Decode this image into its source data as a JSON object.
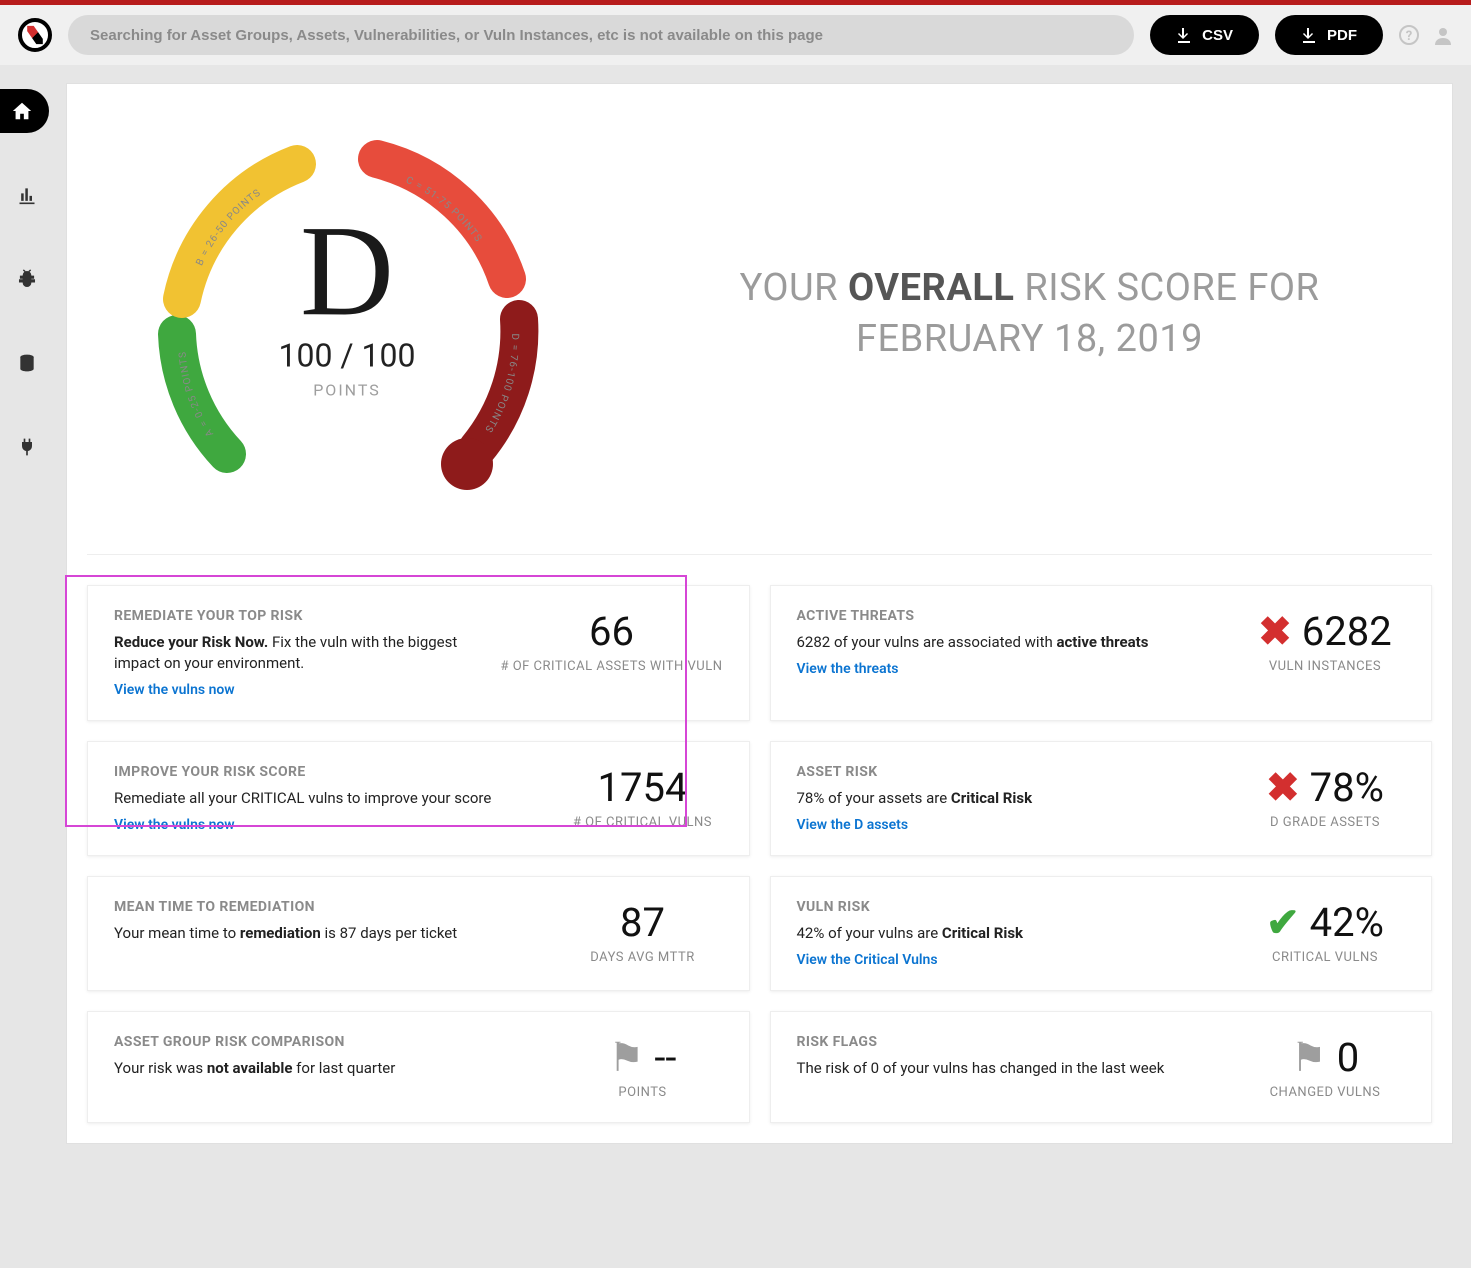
{
  "search": {
    "placeholder": "Searching for Asset Groups, Assets, Vulnerabilities, or Vuln Instances, etc is not available on this page"
  },
  "buttons": {
    "csv": "CSV",
    "pdf": "PDF"
  },
  "hero": {
    "prefix": "YOUR ",
    "strong": "OVERALL",
    "suffix": " RISK SCORE FOR",
    "date": "FEBRUARY 18, 2019",
    "grade": "D",
    "score_value": "100 / 100",
    "score_label": "POINTS",
    "segments": {
      "a": "A = 0-25 POINTS",
      "b": "B = 26-50 POINTS",
      "c": "C = 51-75 POINTS",
      "d": "D = 76-100 POINTS"
    }
  },
  "cards": {
    "remediate": {
      "title": "REMEDIATE YOUR TOP RISK",
      "lead": "Reduce your Risk Now.",
      "desc": " Fix the vuln with the biggest impact on your environment.",
      "link": "View the vulns now",
      "stat": "66",
      "stat_label": "# OF CRITICAL ASSETS WITH VULN"
    },
    "threats": {
      "title": "ACTIVE THREATS",
      "desc_pre": "6282 of your vulns are associated with ",
      "desc_bold": "active threats",
      "link": "View the threats",
      "stat": "6282",
      "stat_label": "VULN INSTANCES"
    },
    "improve": {
      "title": "IMPROVE YOUR RISK SCORE",
      "desc": "Remediate all your CRITICAL vulns to improve your score",
      "link": "View the vulns now",
      "stat": "1754",
      "stat_label": "# OF CRITICAL VULNS"
    },
    "assetrisk": {
      "title": "ASSET RISK",
      "desc_pre": "78% of your assets are ",
      "desc_bold": "Critical Risk",
      "link": "View the D assets",
      "stat": "78%",
      "stat_label": "D GRADE ASSETS"
    },
    "mttr": {
      "title": "MEAN TIME TO REMEDIATION",
      "desc_pre": "Your mean time to ",
      "desc_bold": "remediation",
      "desc_post": " is 87 days per ticket",
      "stat": "87",
      "stat_label": "DAYS AVG MTTR"
    },
    "vulnrisk": {
      "title": "VULN RISK",
      "desc_pre": "42% of your vulns are ",
      "desc_bold": "Critical Risk",
      "link": "View the Critical Vulns",
      "stat": "42%",
      "stat_label": "CRITICAL VULNS"
    },
    "comparison": {
      "title": "ASSET GROUP RISK COMPARISON",
      "desc_pre": "Your risk was ",
      "desc_bold": "not available",
      "desc_post": " for last quarter",
      "stat": "--",
      "stat_label": "POINTS"
    },
    "flags": {
      "title": "RISK FLAGS",
      "desc": "The risk of 0 of your vulns has changed in the last week",
      "stat": "0",
      "stat_label": "CHANGED VULNS"
    }
  },
  "chart_data": {
    "type": "gauge",
    "title": "Overall Risk Score",
    "value": 100,
    "max": 100,
    "grade": "D",
    "segments": [
      {
        "label": "A",
        "range": [
          0,
          25
        ],
        "color": "#3fa83f",
        "text": "A = 0-25 POINTS"
      },
      {
        "label": "B",
        "range": [
          26,
          50
        ],
        "color": "#f1c232",
        "text": "B = 26-50 POINTS"
      },
      {
        "label": "C",
        "range": [
          51,
          75
        ],
        "color": "#e74c3c",
        "text": "C = 51-75 POINTS"
      },
      {
        "label": "D",
        "range": [
          76,
          100
        ],
        "color": "#8e1b1b",
        "text": "D = 76-100 POINTS"
      }
    ]
  }
}
